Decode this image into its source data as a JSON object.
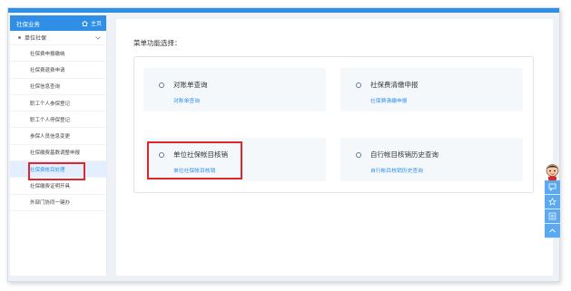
{
  "sidebar": {
    "header_title": "社保业务",
    "home_label": "主页",
    "group_label": "单位社保",
    "items": [
      {
        "label": "社保费申报缴纳"
      },
      {
        "label": "社保费退费申请"
      },
      {
        "label": "社保信息查询"
      },
      {
        "label": "职工个人参保登记"
      },
      {
        "label": "职工个人停保登记"
      },
      {
        "label": "参保人员信息变更"
      },
      {
        "label": "社保缴费基数调整申报"
      },
      {
        "label": "社保费帐目处理"
      },
      {
        "label": "社保缴费证明开具"
      },
      {
        "label": "外部门协同一键办"
      }
    ],
    "active_index": 7
  },
  "main": {
    "section_title": "菜单功能选择：",
    "cards": [
      {
        "title": "对账单查询",
        "subtitle": "对账单查询"
      },
      {
        "title": "社保费清缴申报",
        "subtitle": "社保费清缴申报"
      },
      {
        "title": "单位社保帐目核销",
        "subtitle": "单位社保帐目核销"
      },
      {
        "title": "自行帐目核销历史查询",
        "subtitle": "自行帐目核销历史查询"
      }
    ]
  },
  "widget": {
    "buttons": [
      "chat-icon",
      "star-icon",
      "list-icon",
      "up-arrow-icon"
    ]
  },
  "colors": {
    "accent": "#2f8fe6",
    "highlight": "#e0262b",
    "background": "#eef2f7"
  }
}
